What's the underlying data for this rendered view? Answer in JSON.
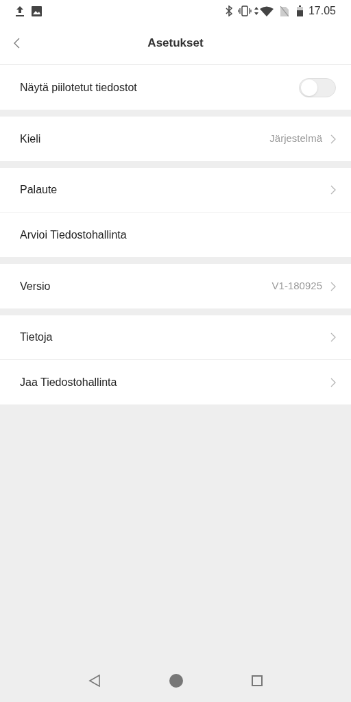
{
  "status_bar": {
    "time": "17.05"
  },
  "header": {
    "title": "Asetukset"
  },
  "groups": [
    {
      "rows": [
        {
          "kind": "toggle",
          "label": "Näytä piilotetut tiedostot",
          "on": false
        }
      ]
    },
    {
      "rows": [
        {
          "kind": "link",
          "label": "Kieli",
          "value": "Järjestelmä",
          "chevron": true
        }
      ]
    },
    {
      "rows": [
        {
          "kind": "link",
          "label": "Palaute",
          "chevron": true
        },
        {
          "kind": "link",
          "label": "Arvioi Tiedostohallinta",
          "chevron": false
        }
      ]
    },
    {
      "rows": [
        {
          "kind": "link",
          "label": "Versio",
          "value": "V1-180925",
          "chevron": true
        }
      ]
    },
    {
      "rows": [
        {
          "kind": "link",
          "label": "Tietoja",
          "chevron": true
        },
        {
          "kind": "link",
          "label": "Jaa Tiedostohallinta",
          "chevron": true
        }
      ]
    }
  ]
}
